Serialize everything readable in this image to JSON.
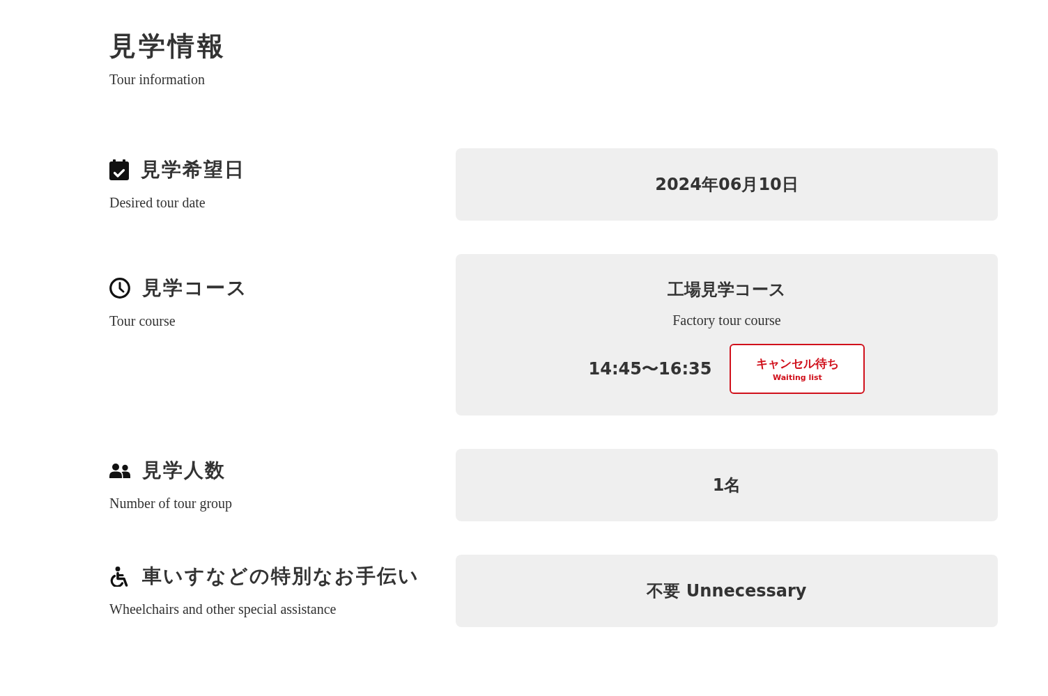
{
  "heading": {
    "title": "見学情報",
    "subtitle": "Tour information"
  },
  "items": [
    {
      "kind": "text",
      "label": "見学希望日",
      "sublabel": "Desired tour date",
      "value": "2024年06月10日"
    },
    {
      "kind": "course",
      "label": "見学コース",
      "sublabel": "Tour course",
      "course_name": "工場見学コース",
      "course_name_en": "Factory tour course",
      "time": "14:45〜16:35",
      "status": {
        "label": "キャンセル待ち",
        "sublabel": "Waiting list"
      }
    },
    {
      "kind": "text",
      "label": "見学人数",
      "sublabel": "Number of tour group",
      "value": "1名"
    },
    {
      "kind": "text",
      "label": "車いすなどの特別なお手伝い",
      "sublabel": "Wheelchairs and other special assistance",
      "value": "不要 Unnecessary"
    }
  ]
}
